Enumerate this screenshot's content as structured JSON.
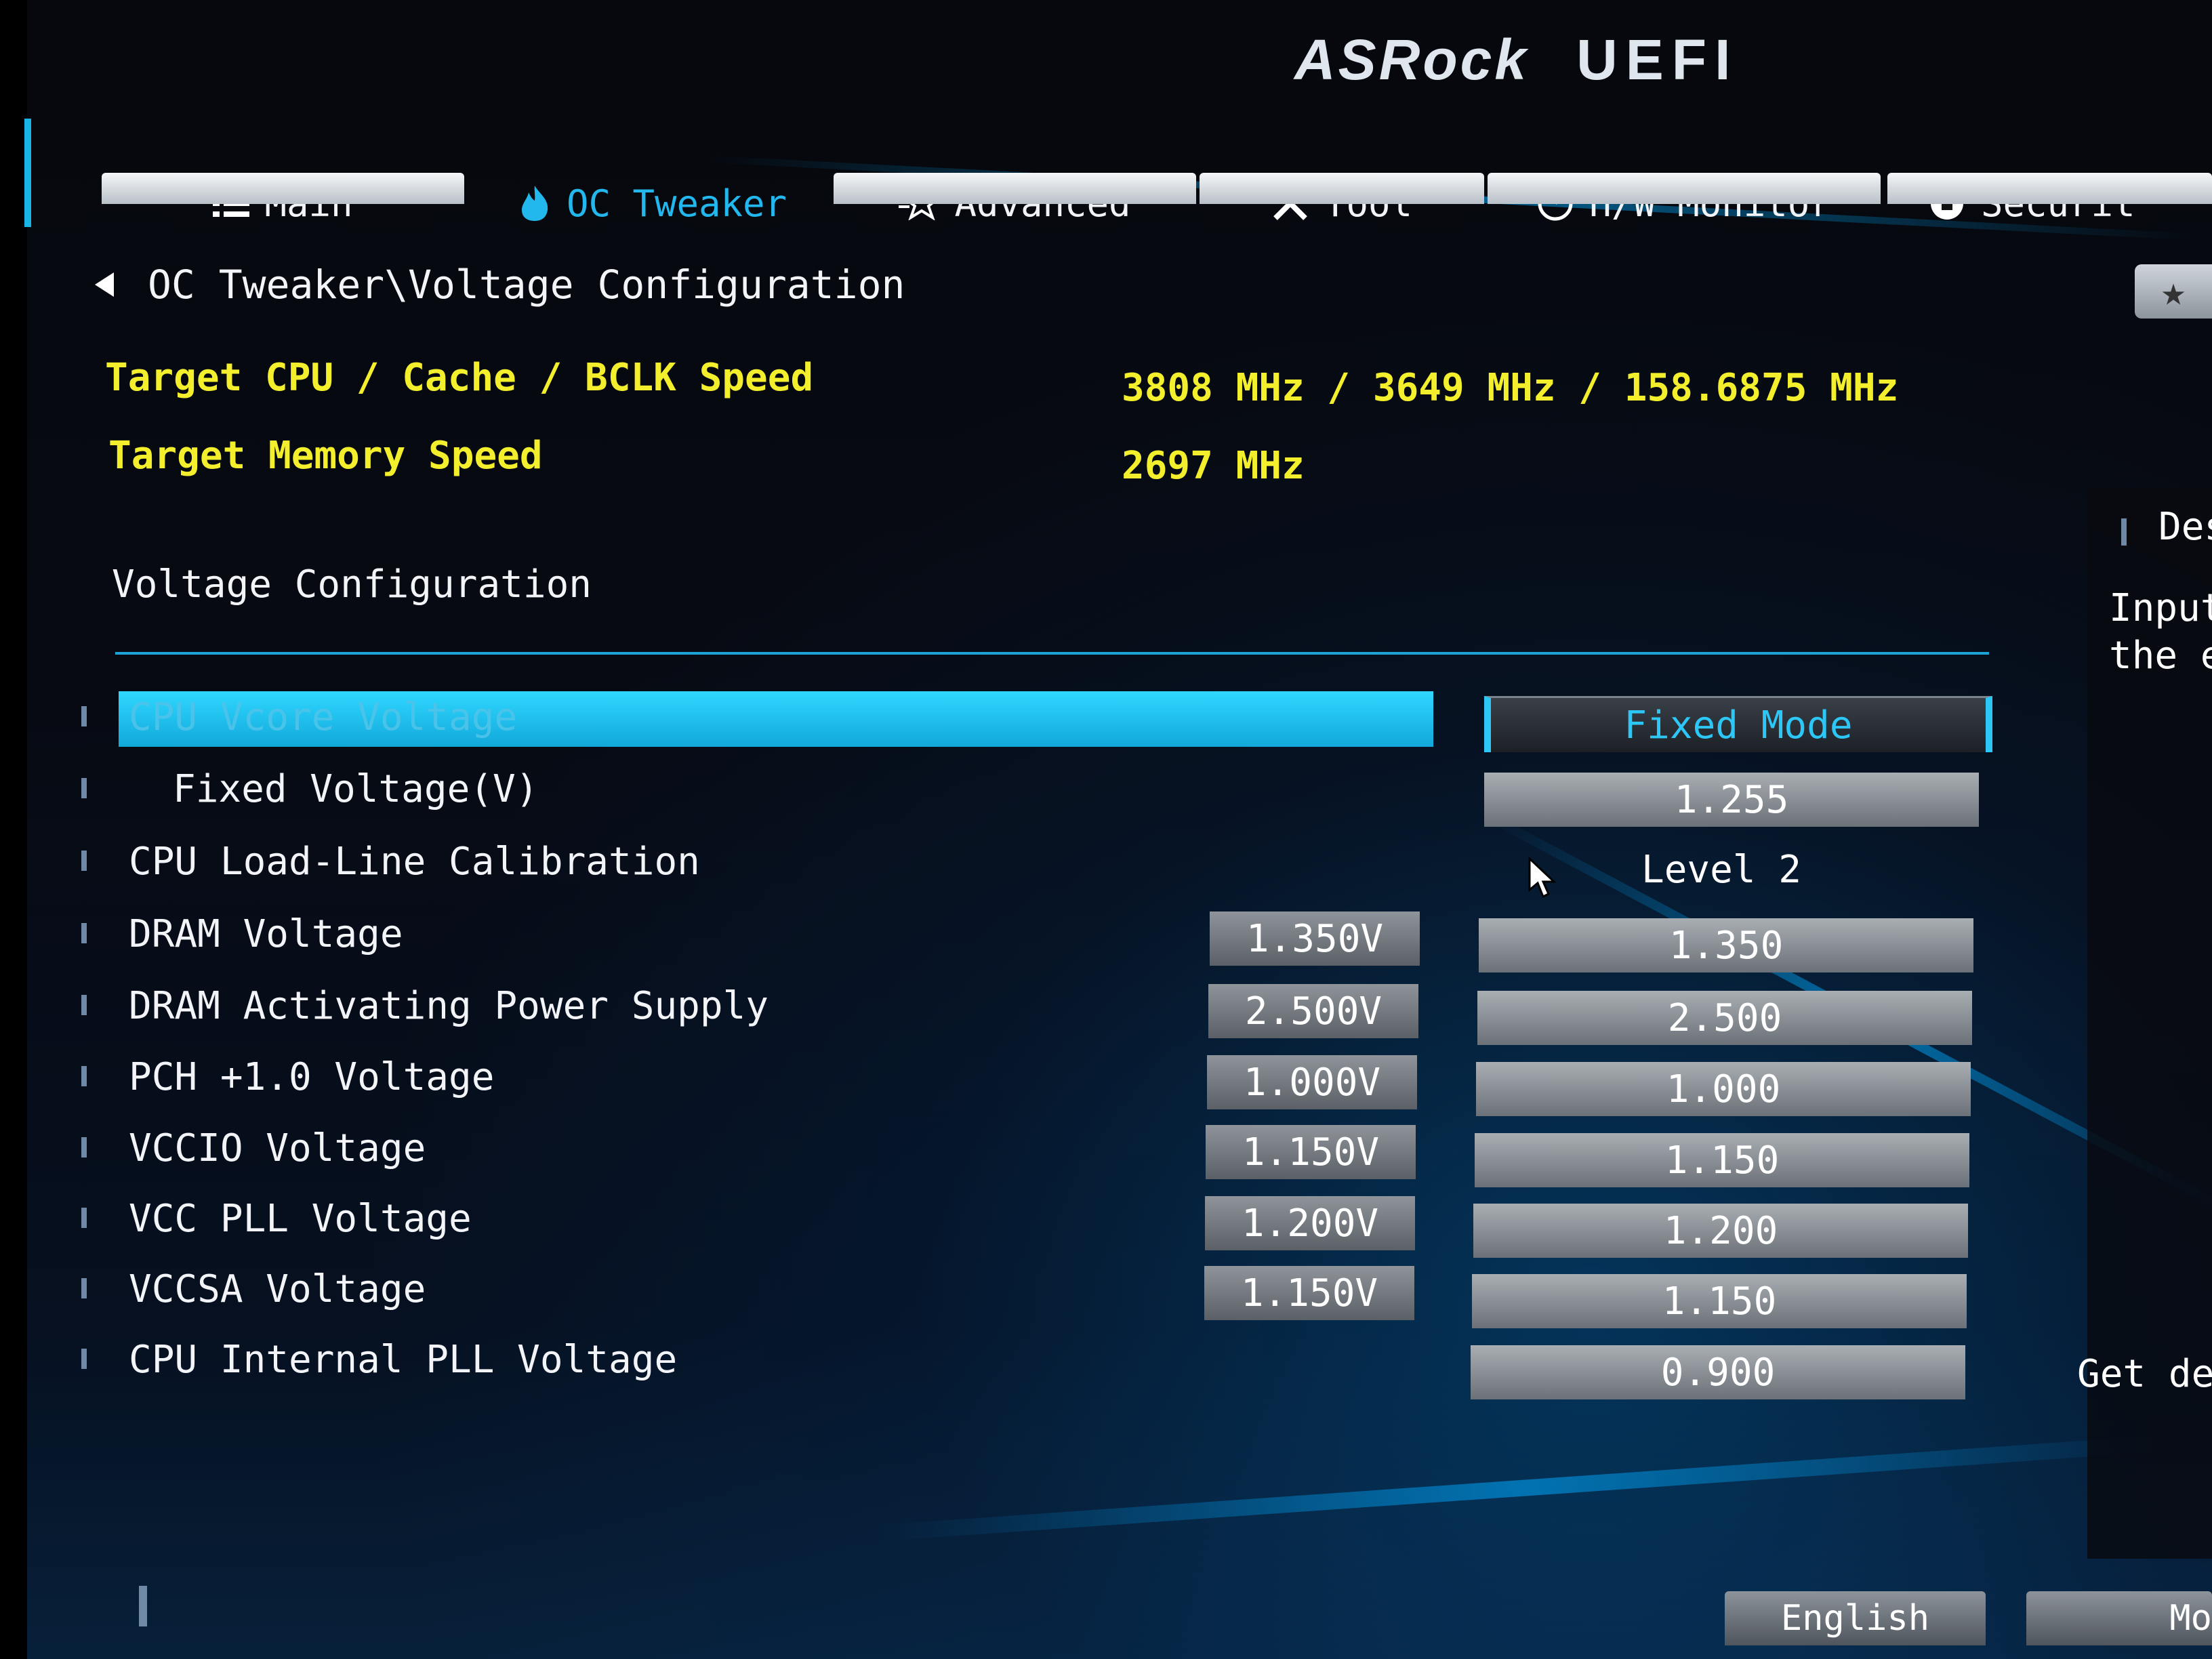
{
  "header": {
    "brand": "ASRock",
    "product": "UEFI"
  },
  "tabs": [
    {
      "label": "Main",
      "icon": "list-icon"
    },
    {
      "label": "OC Tweaker",
      "icon": "flame-icon"
    },
    {
      "label": "Advanced",
      "icon": "star-icon"
    },
    {
      "label": "Tool",
      "icon": "tools-icon"
    },
    {
      "label": "H/W Monitor",
      "icon": "monitor-icon"
    },
    {
      "label": "Securit",
      "icon": "shield-icon"
    }
  ],
  "breadcrumb": {
    "path": "OC Tweaker\\Voltage Configuration"
  },
  "info": {
    "target_cpu_label": "Target CPU / Cache / BCLK Speed",
    "target_cpu_value": "3808 MHz / 3649 MHz / 158.6875 MHz",
    "target_mem_label": "Target Memory Speed",
    "target_mem_value": "2697 MHz"
  },
  "section": {
    "title": "Voltage Configuration"
  },
  "settings": [
    {
      "label": "CPU Vcore Voltage",
      "current": "",
      "value": "Fixed Mode"
    },
    {
      "label": "Fixed Voltage(V)",
      "current": "",
      "value": "1.255"
    },
    {
      "label": "CPU Load-Line Calibration",
      "current": "",
      "value": "Level 2"
    },
    {
      "label": "DRAM Voltage",
      "current": "1.350V",
      "value": "1.350"
    },
    {
      "label": "DRAM Activating Power Supply",
      "current": "2.500V",
      "value": "2.500"
    },
    {
      "label": "PCH +1.0 Voltage",
      "current": "1.000V",
      "value": "1.000"
    },
    {
      "label": "VCCIO Voltage",
      "current": "1.150V",
      "value": "1.150"
    },
    {
      "label": "VCC PLL Voltage",
      "current": "1.200V",
      "value": "1.200"
    },
    {
      "label": "VCCSA Voltage",
      "current": "1.150V",
      "value": "1.150"
    },
    {
      "label": "CPU Internal PLL Voltage",
      "current": "",
      "value": "0.900"
    }
  ],
  "description": {
    "title": "Des",
    "line1": "Input",
    "line2": "the e",
    "footer": "Get de"
  },
  "bottom": {
    "language": "English",
    "mode": "Mo"
  },
  "colors": {
    "accent": "#22b8ee",
    "info_text": "#f3ef2c",
    "highlight": "#2fd7ff"
  }
}
